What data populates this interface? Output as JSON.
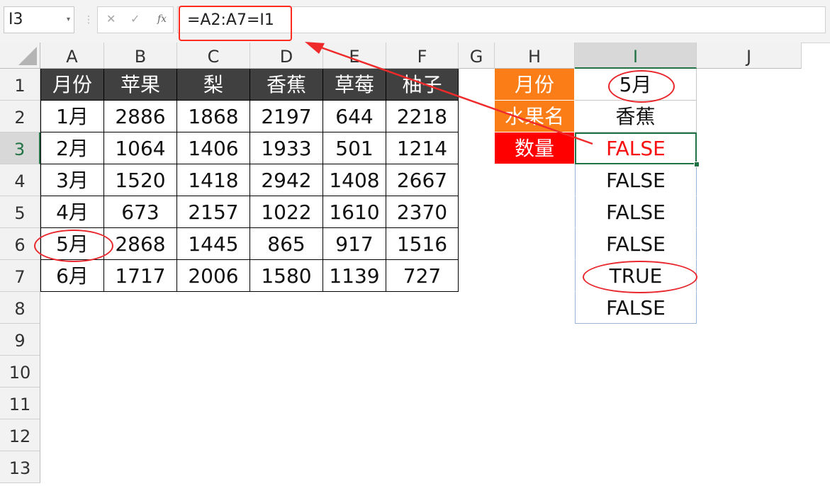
{
  "formula_bar": {
    "name_box": "I3",
    "name_box_dropdown": "▾",
    "separator": "⋮",
    "cancel_label": "✕",
    "enter_label": "✓",
    "fx_label": "fx",
    "formula": "=A2:A7=I1"
  },
  "columns": [
    "A",
    "B",
    "C",
    "D",
    "E",
    "F",
    "G",
    "H",
    "I",
    "J"
  ],
  "rows": [
    "1",
    "2",
    "3",
    "4",
    "5",
    "6",
    "7",
    "8",
    "9",
    "10",
    "11",
    "12",
    "13"
  ],
  "selected": {
    "cell": "I3",
    "column": "I",
    "row": "3"
  },
  "table": {
    "headers": [
      "月份",
      "苹果",
      "梨",
      "香蕉",
      "草莓",
      "柚子"
    ],
    "rows": [
      [
        "1月",
        "2886",
        "1868",
        "2197",
        "644",
        "2218"
      ],
      [
        "2月",
        "1064",
        "1406",
        "1933",
        "501",
        "1214"
      ],
      [
        "3月",
        "1520",
        "1418",
        "2942",
        "1408",
        "2667"
      ],
      [
        "4月",
        "673",
        "2157",
        "1022",
        "1610",
        "2370"
      ],
      [
        "5月",
        "2868",
        "1445",
        "865",
        "917",
        "1516"
      ],
      [
        "6月",
        "1717",
        "2006",
        "1580",
        "1139",
        "727"
      ]
    ]
  },
  "lookup": {
    "labels": [
      "月份",
      "水果名",
      "数量"
    ],
    "values": [
      "5月",
      "香蕉"
    ],
    "results": [
      "FALSE",
      "FALSE",
      "FALSE",
      "FALSE",
      "TRUE",
      "FALSE"
    ]
  },
  "colors": {
    "table_header_bg": "#404040",
    "label_orange": "#fb7d17",
    "label_red": "#fe0000",
    "annotation_red": "#e8262c",
    "selection_green": "#217346"
  }
}
